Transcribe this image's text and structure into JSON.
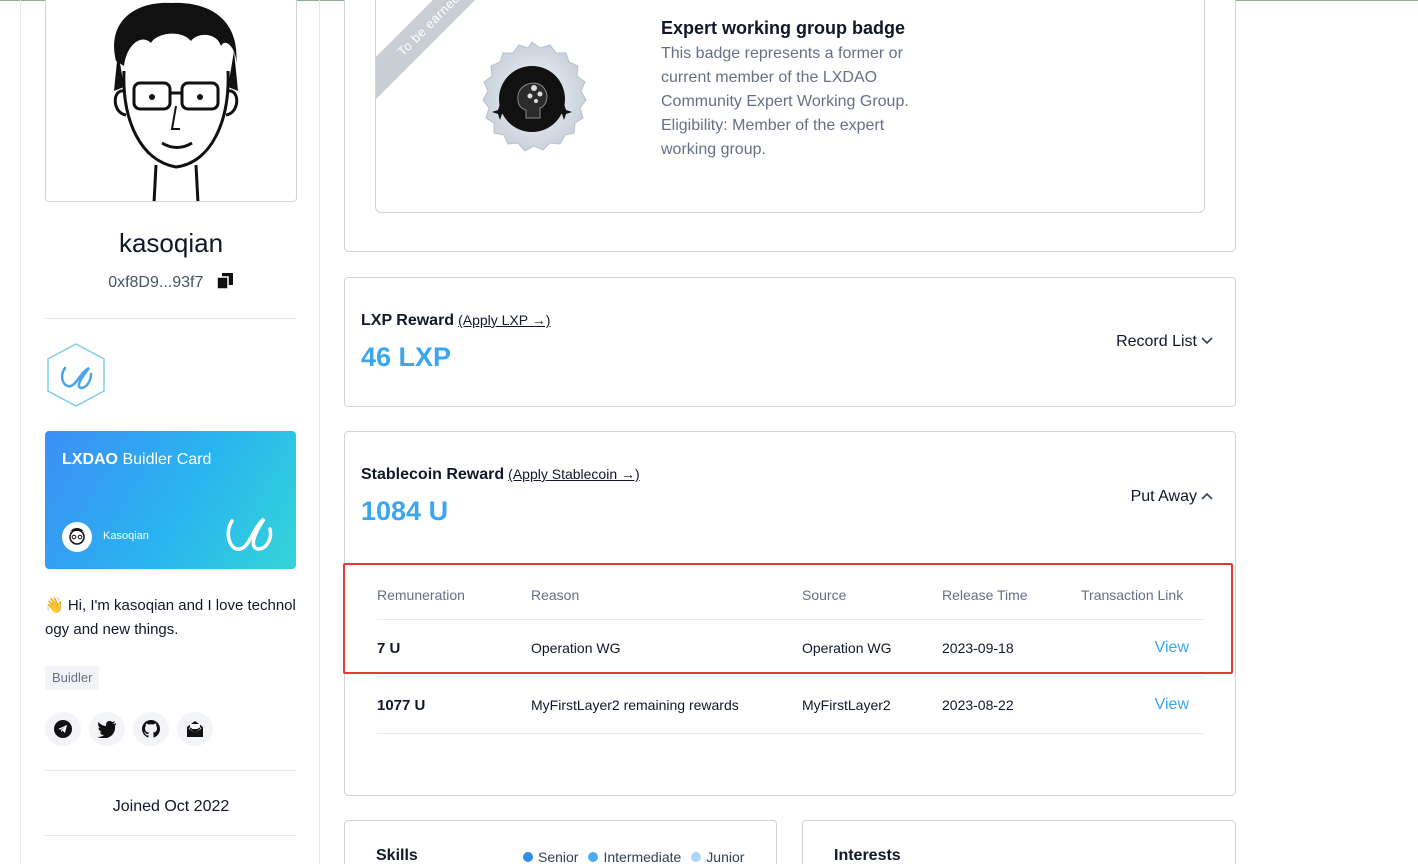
{
  "profile": {
    "username": "kasoqian",
    "address": "0xf8D9...93f7",
    "bio": "👋 Hi, I'm kasoqian and I love technology and new things.",
    "role": "Buidler",
    "joined": "Joined Oct 2022",
    "card": {
      "title_brand": "LXDAO",
      "title_rest": " Buidler Card",
      "name": "Kasoqian"
    },
    "socials": [
      "telegram-icon",
      "twitter-icon",
      "github-icon",
      "email-icon"
    ]
  },
  "badge": {
    "ribbon": "To be earned",
    "title": "Expert working group badge",
    "description": "This badge represents a former or current member of the LXDAO Community Expert Working Group.",
    "eligibility": "Eligibility: Member of the expert working group."
  },
  "lxp": {
    "label": "LXP Reward",
    "apply": "(Apply LXP →)",
    "amount": "46 LXP",
    "toggle": "Record List"
  },
  "stablecoin": {
    "label": "Stablecoin Reward",
    "apply": "(Apply Stablecoin →)",
    "amount": "1084 U",
    "toggle": "Put Away",
    "columns": [
      "Remuneration",
      "Reason",
      "Source",
      "Release Time",
      "Transaction Link"
    ],
    "rows": [
      {
        "amount": "7 U",
        "reason": "Operation WG",
        "source": "Operation WG",
        "time": "2023-09-18",
        "link": "View"
      },
      {
        "amount": "1077 U",
        "reason": "MyFirstLayer2 remaining rewards",
        "source": "MyFirstLayer2",
        "time": "2023-08-22",
        "link": "View"
      }
    ]
  },
  "skills": {
    "title": "Skills",
    "legend": [
      {
        "label": "Senior",
        "color": "#2e8fe6"
      },
      {
        "label": "Intermediate",
        "color": "#4eaaf0"
      },
      {
        "label": "Junior",
        "color": "#a9d6fa"
      }
    ]
  },
  "interests": {
    "title": "Interests"
  },
  "colors": {
    "accent": "#3ba6ee",
    "highlight": "#e53935"
  }
}
